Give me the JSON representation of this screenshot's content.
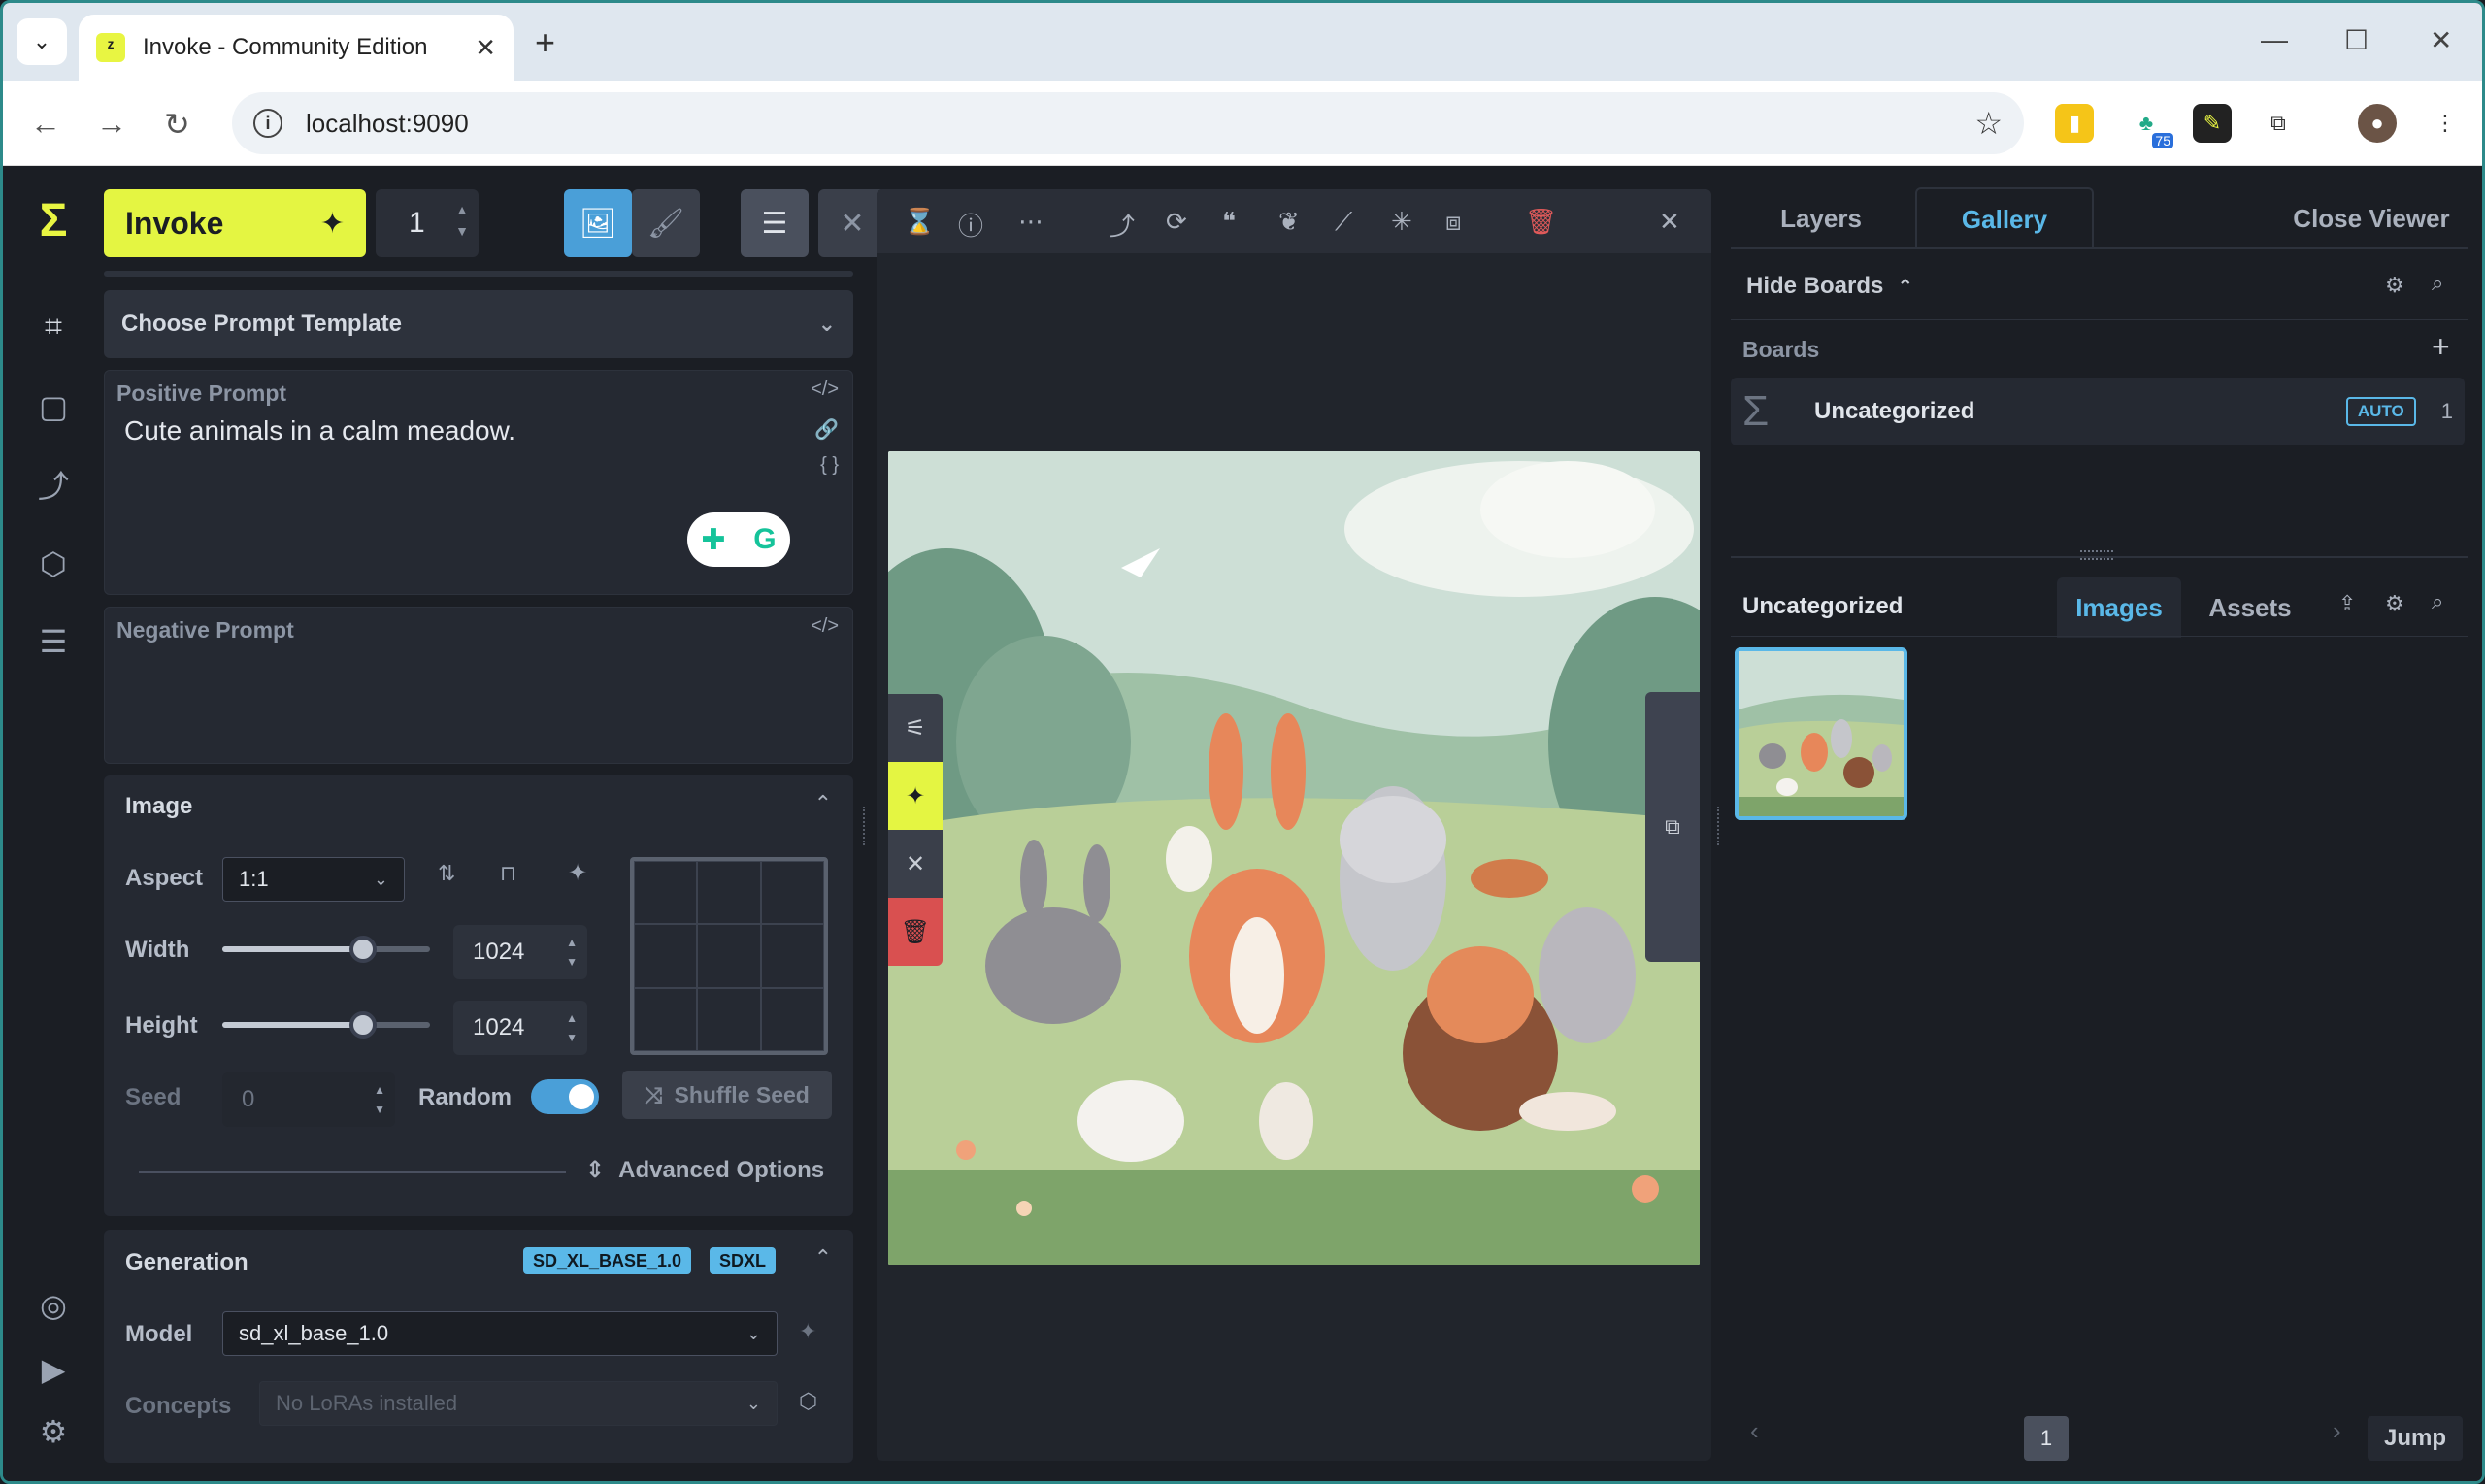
{
  "browser": {
    "tab_title": "Invoke - Community Edition",
    "url": "localhost:9090",
    "ext_badge": "75"
  },
  "left": {
    "invoke_label": "Invoke",
    "count": "1",
    "prompt_template": "Choose Prompt Template",
    "positive_label": "Positive Prompt",
    "positive_text": "Cute animals in a calm meadow.",
    "negative_label": "Negative Prompt",
    "image_section": "Image",
    "aspect_label": "Aspect",
    "aspect_value": "1:1",
    "width_label": "Width",
    "width_value": "1024",
    "width_fraction": 0.64,
    "height_label": "Height",
    "height_value": "1024",
    "height_fraction": 0.64,
    "seed_label": "Seed",
    "seed_value": "0",
    "random_label": "Random",
    "random_on": true,
    "shuffle_label": "Shuffle Seed",
    "advanced_label": "Advanced Options",
    "generation_section": "Generation",
    "badge_model": "SD_XL_BASE_1.0",
    "badge_arch": "SDXL",
    "model_label": "Model",
    "model_value": "sd_xl_base_1.0",
    "concepts_label": "Concepts",
    "concepts_placeholder": "No LoRAs installed"
  },
  "right": {
    "tab_layers": "Layers",
    "tab_gallery": "Gallery",
    "close_viewer": "Close Viewer",
    "hide_boards": "Hide Boards",
    "boards_label": "Boards",
    "board_name": "Uncategorized",
    "board_auto": "AUTO",
    "board_count": "1",
    "gallery_board": "Uncategorized",
    "tab_images": "Images",
    "tab_assets": "Assets",
    "page": "1",
    "jump": "Jump"
  },
  "colors": {
    "accent": "#e4f542",
    "blue": "#5ab8e8",
    "bg": "#1b1e24"
  }
}
